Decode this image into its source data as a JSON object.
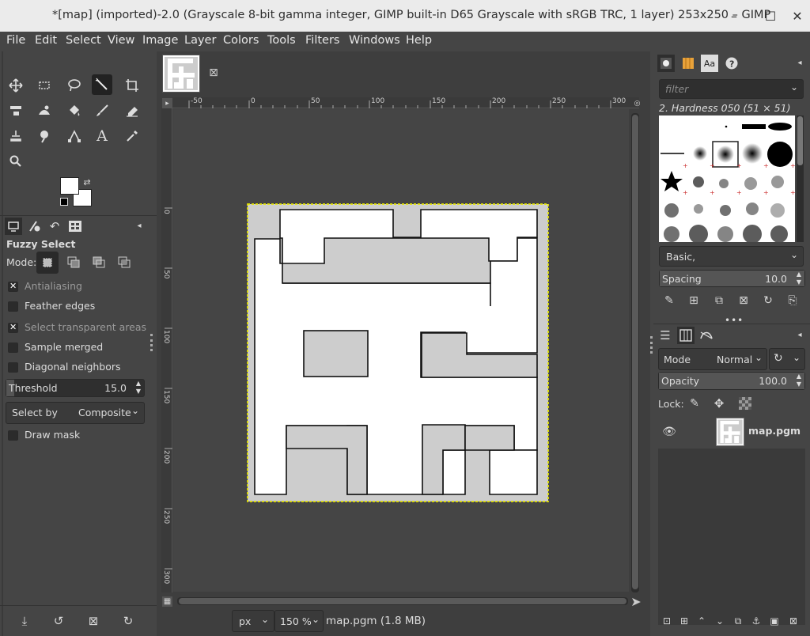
{
  "window": {
    "title": "*[map] (imported)-2.0 (Grayscale 8-bit gamma integer, GIMP built-in D65 Grayscale with sRGB TRC, 1 layer) 253x250 – GIMP",
    "minimize": "–",
    "maximize": "☐",
    "close": "✕"
  },
  "menu": [
    "File",
    "Edit",
    "Select",
    "View",
    "Image",
    "Layer",
    "Colors",
    "Tools",
    "Filters",
    "Windows",
    "Help"
  ],
  "tool_options": {
    "title": "Fuzzy Select",
    "mode_label": "Mode:",
    "options": [
      {
        "label": "Antialiasing",
        "checked": true,
        "dim": true
      },
      {
        "label": "Feather edges",
        "checked": false,
        "dim": false
      },
      {
        "label": "Select transparent areas",
        "checked": true,
        "dim": true
      },
      {
        "label": "Sample merged",
        "checked": false,
        "dim": false
      },
      {
        "label": "Diagonal neighbors",
        "checked": false,
        "dim": false
      }
    ],
    "threshold_label": "Threshold",
    "threshold_value": "15.0",
    "threshold_fraction": 0.06,
    "select_by_label": "Select by",
    "select_by_value": "Composite",
    "draw_mask_label": "Draw mask"
  },
  "canvas": {
    "ruler_h": [
      "-50",
      "0",
      "50",
      "100",
      "150",
      "200",
      "250",
      "300"
    ],
    "ruler_v": [
      "0",
      "50",
      "100",
      "150",
      "200",
      "250",
      "300"
    ],
    "unit": "px",
    "zoom": "150 %",
    "status": "map.pgm (1.8 MB)"
  },
  "brushes": {
    "filter_placeholder": "filter",
    "current_brush": "2. Hardness 050 (51 × 51)",
    "preset": "Basic,",
    "spacing_label": "Spacing",
    "spacing_value": "10.0"
  },
  "layers": {
    "mode_label": "Mode",
    "mode_value": "Normal",
    "opacity_label": "Opacity",
    "opacity_value": "100.0",
    "lock_label": "Lock:",
    "items": [
      {
        "name": "map.pgm",
        "visible": true
      }
    ]
  },
  "colors": {
    "panel_bg": "#454545",
    "canvas_bg": "#454545",
    "accent": "#ffffff",
    "image_gray": "#cdcdcd"
  }
}
